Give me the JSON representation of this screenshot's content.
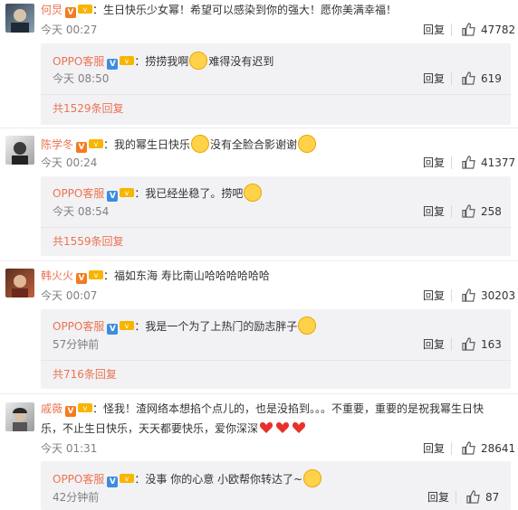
{
  "comments": [
    {
      "username": "何炅",
      "text": "生日快乐少女幂！希望可以感染到你的强大！愿你美满幸福！",
      "time": "今天 00:27",
      "reply_label": "回复",
      "likes": "47782",
      "reply": {
        "username": "OPPO客服",
        "text_a": "捞捞我啊",
        "text_b": "难得没有迟到",
        "time": "今天 08:50",
        "reply_label": "回复",
        "likes": "619"
      },
      "more": "共1529条回复"
    },
    {
      "username": "陈学冬",
      "text_a": "我的幂生日快乐",
      "text_b": "没有全脸合影谢谢",
      "time": "今天 00:24",
      "reply_label": "回复",
      "likes": "41377",
      "reply": {
        "username": "OPPO客服",
        "text_a": "我已经坐稳了。捞吧",
        "time": "今天 08:54",
        "reply_label": "回复",
        "likes": "258"
      },
      "more": "共1559条回复"
    },
    {
      "username": "韩火火",
      "text": "福如东海 寿比南山哈哈哈哈哈哈",
      "time": "今天 00:07",
      "reply_label": "回复",
      "likes": "30203",
      "reply": {
        "username": "OPPO客服",
        "text_a": "我是一个为了上热门的励志胖子",
        "time": "57分钟前",
        "reply_label": "回复",
        "likes": "163"
      },
      "more": "共716条回复"
    },
    {
      "username": "戚薇",
      "text_line1": "怪我！渣网络本想掐个点儿的，也是没掐到。。。不重要，重要的是祝我幂生日快",
      "text_line2": "乐，不止生日快乐，天天都要快乐，爱你深深",
      "time": "今天 01:31",
      "reply_label": "回复",
      "likes": "28641",
      "reply": {
        "username": "OPPO客服",
        "text_a": "没事 你的心意 小欧帮你转达了~",
        "time": "42分钟前",
        "reply_label": "回复",
        "likes": "87"
      }
    }
  ],
  "colon": "：",
  "colors": {
    "username": "#eb7350",
    "meta": "#808080",
    "reply_bg": "#f2f2f5"
  }
}
